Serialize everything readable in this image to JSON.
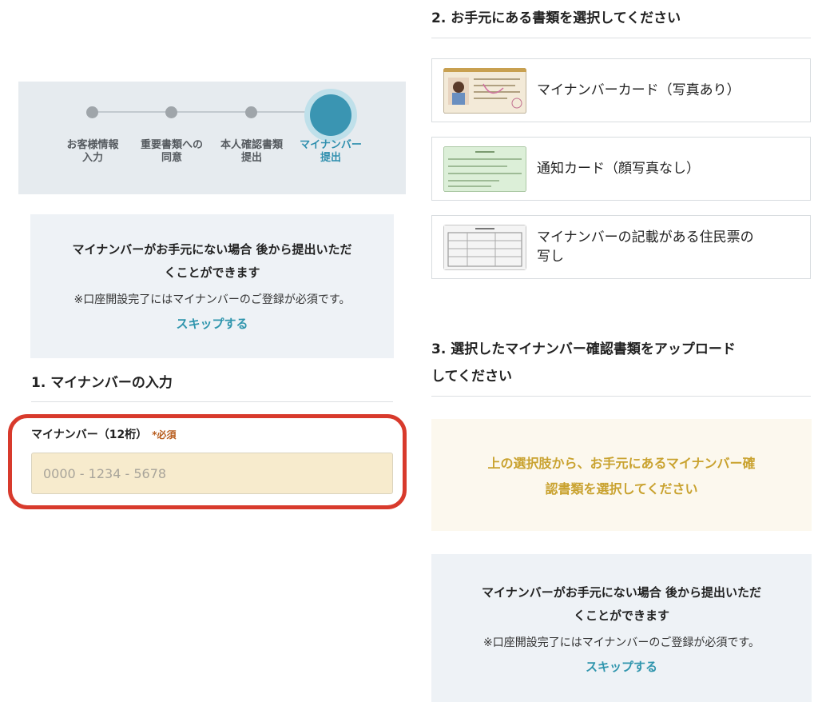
{
  "stepper": {
    "steps": [
      {
        "label": "お客様情報\n入力"
      },
      {
        "label": "重要書類への\n同意"
      },
      {
        "label": "本人確認書類\n提出"
      },
      {
        "label": "マイナンバー\n提出"
      }
    ],
    "current_step": 4
  },
  "notice": {
    "message": "マイナンバーがお手元にない場合 後から提出いただ\nくことができます",
    "note": "※口座開設完了にはマイナンバーのご登録が必須です。",
    "skip_label": "スキップする"
  },
  "section1": {
    "title": "1. マイナンバーの入力",
    "field_label": "マイナンバー（12桁）",
    "required_label": "*必須",
    "placeholder": "0000 - 1234 - 5678",
    "value": ""
  },
  "section2": {
    "title": "2. お手元にある書類を選択してください",
    "documents": [
      {
        "name": "マイナンバーカード（写真あり）",
        "icon": "mynumber-card-thumbnail"
      },
      {
        "name": "通知カード（顔写真なし）",
        "icon": "notification-card-thumbnail"
      },
      {
        "name": "マイナンバーの記載がある住民票の\n写し",
        "icon": "resident-record-thumbnail"
      }
    ]
  },
  "section3": {
    "title": "3. 選択したマイナンバー確認書類をアップロード\nしてください",
    "hint": "上の選択肢から、お手元にあるマイナンバー確\n認書類を選択してください"
  },
  "colors": {
    "accent": "#3a95b2",
    "link": "#2f95ad",
    "warning_text": "#c9a22f",
    "required": "#b75c1d",
    "highlight_border": "#d83a2c",
    "input_bg": "#f7ebcd"
  }
}
